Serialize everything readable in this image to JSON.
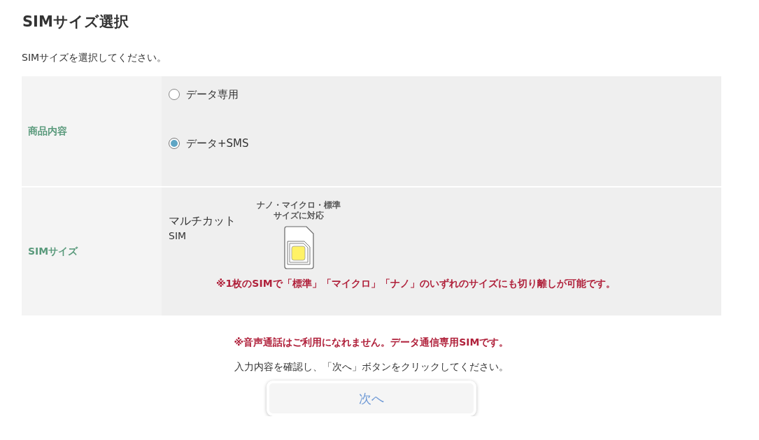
{
  "title": "SIMサイズ選択",
  "intro": "SIMサイズを選択してください。",
  "rows": [
    {
      "label": "商品内容",
      "kind": "radios",
      "options": [
        {
          "label": "データ専用",
          "selected": false
        },
        {
          "label": "データ+SMS",
          "selected": true
        }
      ]
    },
    {
      "label": "SIMサイズ",
      "kind": "sim",
      "name_line1": "マルチカット",
      "name_line2": "SIM",
      "caption_line1": "ナノ・マイクロ・標準",
      "caption_line2": "サイズに対応",
      "note": "※1枚のSIMで「標準」「マイクロ」「ナノ」のいずれのサイズにも切り離しが可能です。"
    }
  ],
  "warning": "※音声通話はご利用になれません。データ通信専用SIMです。",
  "instruction": "入力内容を確認し、「次へ」ボタンをクリックしてください。",
  "next_button": "次へ"
}
